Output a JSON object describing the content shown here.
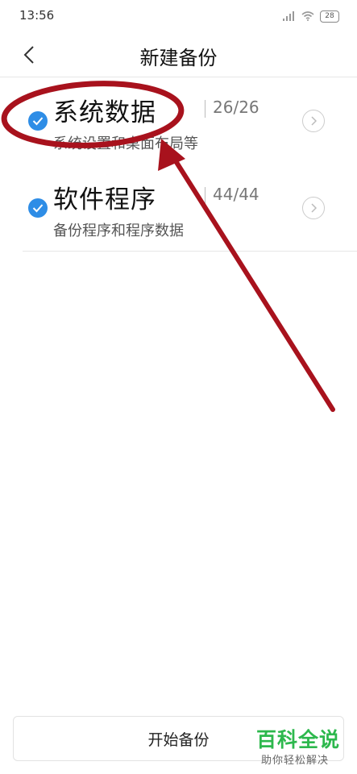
{
  "status": {
    "time": "13:56",
    "battery": "28"
  },
  "header": {
    "title": "新建备份"
  },
  "items": [
    {
      "title": "系统数据",
      "count": "26/26",
      "subtitle": "系统设置和桌面布局等"
    },
    {
      "title": "软件程序",
      "count": "44/44",
      "subtitle": "备份程序和程序数据"
    }
  ],
  "footer": {
    "button_label": "开始备份"
  },
  "watermark": {
    "title": "百科全说",
    "subtitle": "助你轻松解决"
  },
  "colors": {
    "accent": "#2e8de6",
    "annotation": "#a8121d",
    "watermark": "#2db84d"
  }
}
